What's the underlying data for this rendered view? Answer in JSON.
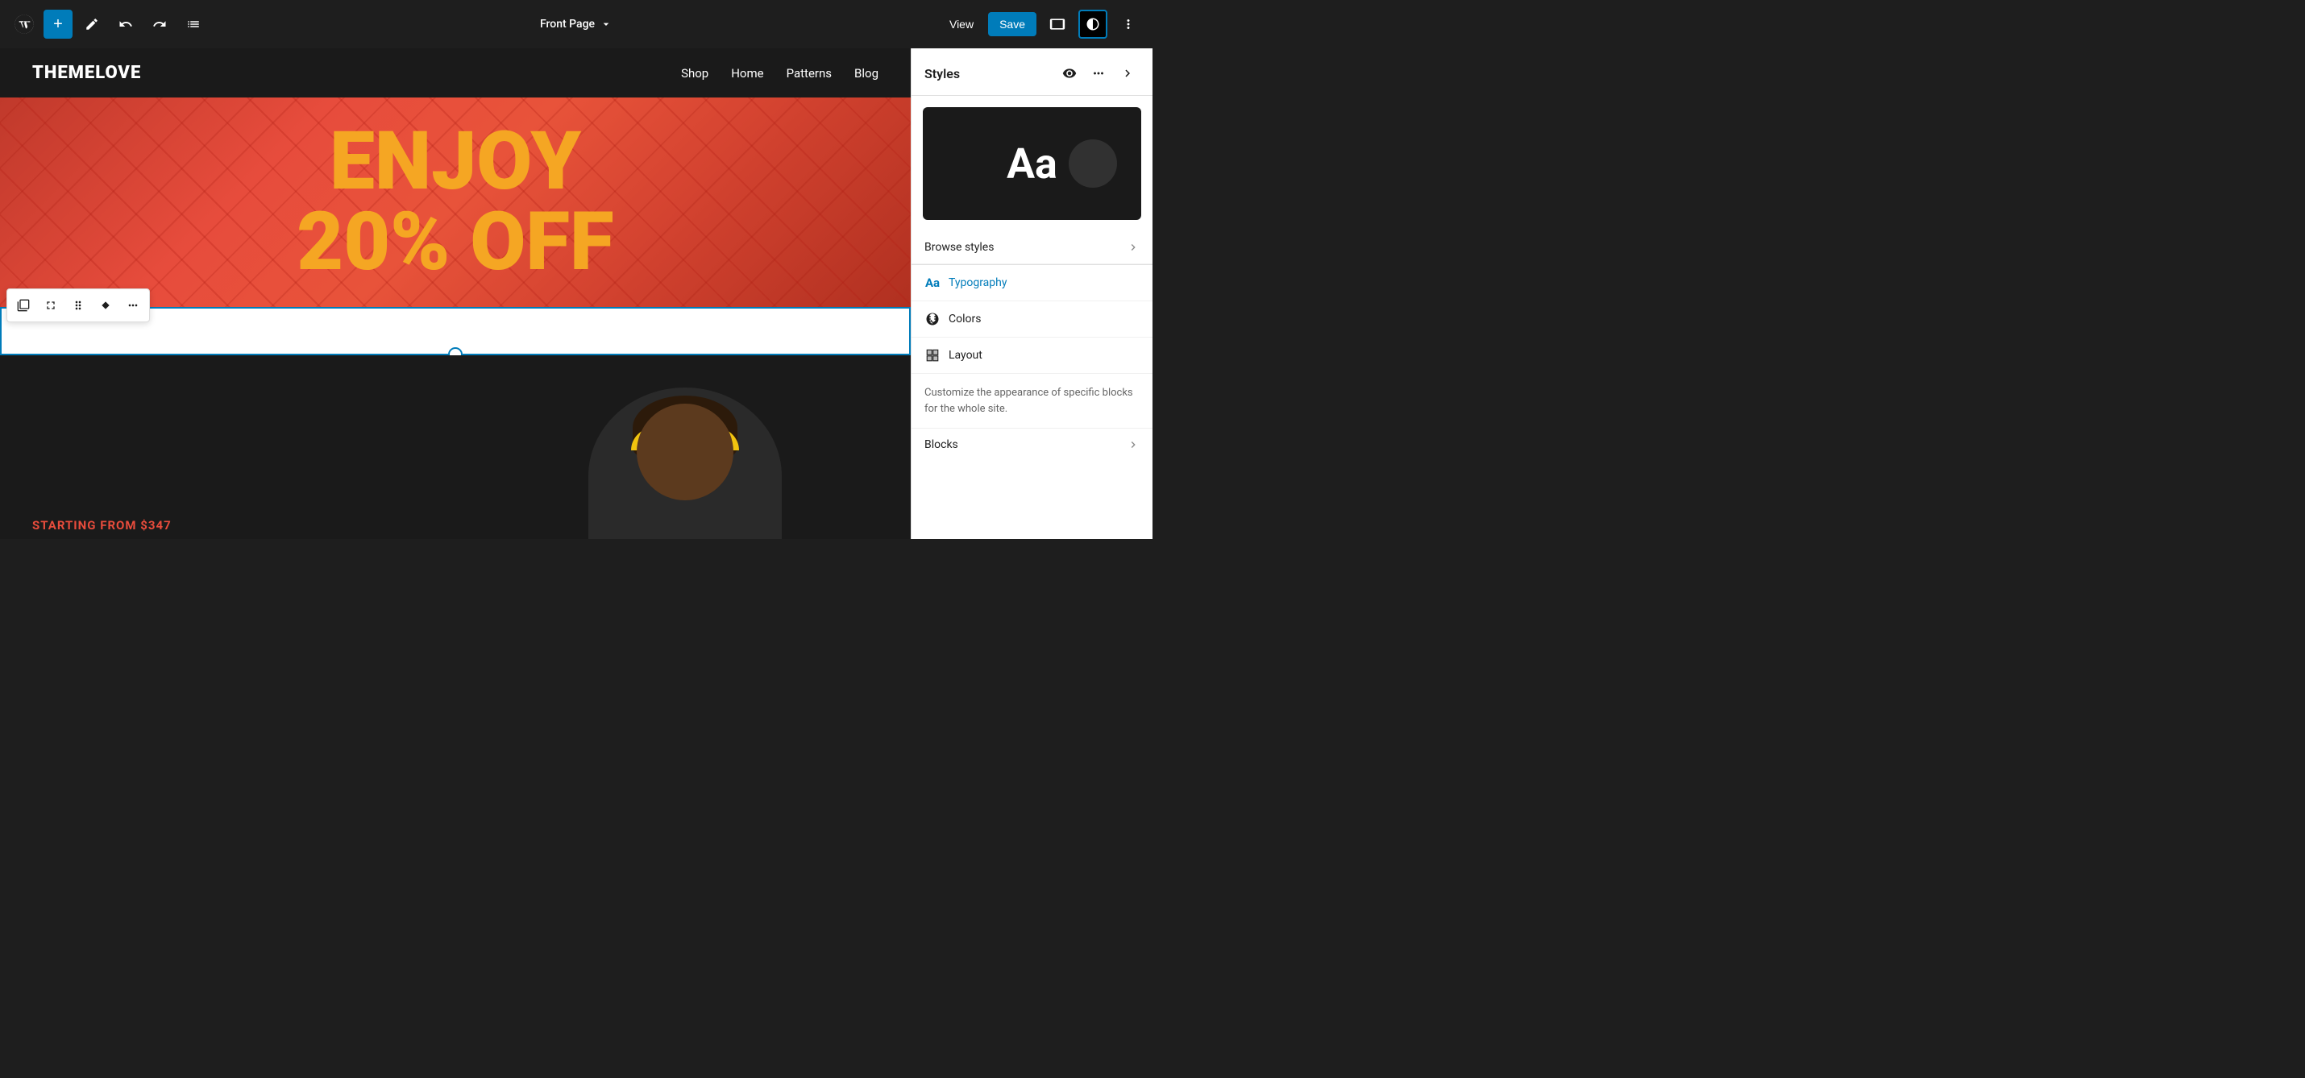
{
  "toolbar": {
    "wp_logo_alt": "WordPress",
    "add_label": "+",
    "page_title": "Front Page",
    "view_label": "View",
    "save_label": "Save"
  },
  "site": {
    "logo": "THEMELOVE",
    "nav": [
      "Shop",
      "Home",
      "Patterns",
      "Blog"
    ]
  },
  "hero": {
    "line1": "ENJOY",
    "line2": "20% OFF"
  },
  "dark_section": {
    "starting_from": "STARTING FROM $347"
  },
  "panel": {
    "title": "Styles",
    "preview_text": "Aa",
    "browse_styles_label": "Browse styles",
    "typography_label": "Typography",
    "colors_label": "Colors",
    "layout_label": "Layout",
    "description": "Customize the appearance of specific blocks for the whole site.",
    "blocks_label": "Blocks"
  }
}
